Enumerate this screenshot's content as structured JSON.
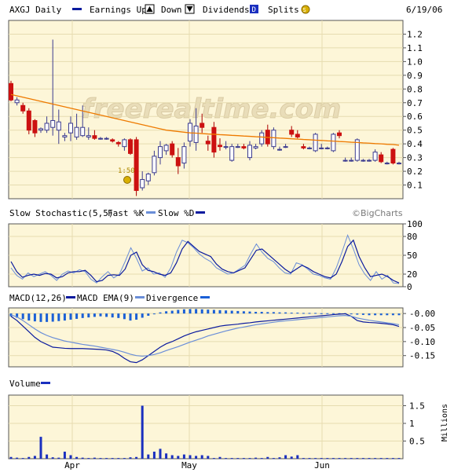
{
  "header": {
    "symbol_label": "AXGJ Daily",
    "legend_earnings": "Earnings Up",
    "legend_down": "Down",
    "legend_dividends": "Dividends",
    "legend_splits": "Splits",
    "date": "6/19/06"
  },
  "watermark": "freerealtime.com",
  "credit": "©BigCharts",
  "split_label": "1:50",
  "colors": {
    "up": "#ffffff",
    "up_border": "#3b3b8f",
    "down": "#cc1111",
    "ma": "#ee7a00",
    "panel_bg": "#fdf6d8",
    "grid": "#e6dcb0",
    "blue_dark": "#0a1a9e",
    "blue_light": "#6a8ed8",
    "hist": "#1a5fd6",
    "volume": "#1a2fbf"
  },
  "chart_data": [
    {
      "type": "candlestick",
      "title": "AXGJ Daily",
      "ylim": [
        0,
        1.3
      ],
      "y_ticks": [
        1.2,
        1.1,
        1.0,
        0.9,
        0.8,
        0.7,
        0.6,
        0.5,
        0.4,
        0.3,
        0.2,
        0.1
      ],
      "x_ticks": [
        "Apr",
        "May",
        "Jun"
      ],
      "ohlc": [
        [
          0.84,
          0.86,
          0.71,
          0.72
        ],
        [
          0.7,
          0.74,
          0.68,
          0.72
        ],
        [
          0.68,
          0.7,
          0.62,
          0.64
        ],
        [
          0.64,
          0.66,
          0.47,
          0.5
        ],
        [
          0.57,
          0.58,
          0.45,
          0.48
        ],
        [
          0.5,
          0.52,
          0.48,
          0.51
        ],
        [
          0.5,
          0.6,
          0.48,
          0.55
        ],
        [
          0.52,
          1.16,
          0.46,
          0.57
        ],
        [
          0.5,
          0.65,
          0.4,
          0.56
        ],
        [
          0.45,
          0.48,
          0.42,
          0.46
        ],
        [
          0.48,
          0.6,
          0.42,
          0.55
        ],
        [
          0.45,
          0.62,
          0.43,
          0.52
        ],
        [
          0.46,
          0.68,
          0.45,
          0.52
        ],
        [
          0.45,
          0.52,
          0.43,
          0.46
        ],
        [
          0.46,
          0.5,
          0.43,
          0.44
        ],
        [
          0.44,
          0.45,
          0.43,
          0.44
        ],
        [
          0.44,
          0.45,
          0.43,
          0.44
        ],
        [
          0.43,
          0.44,
          0.41,
          0.42
        ],
        [
          0.41,
          0.42,
          0.38,
          0.4
        ],
        [
          0.38,
          0.44,
          0.35,
          0.43
        ],
        [
          0.43,
          0.44,
          0.32,
          0.33
        ],
        [
          0.43,
          0.45,
          0.02,
          0.06
        ],
        [
          0.08,
          0.2,
          0.06,
          0.14
        ],
        [
          0.13,
          0.19,
          0.1,
          0.18
        ],
        [
          0.19,
          0.35,
          0.17,
          0.31
        ],
        [
          0.3,
          0.42,
          0.25,
          0.38
        ],
        [
          0.35,
          0.4,
          0.32,
          0.39
        ],
        [
          0.4,
          0.42,
          0.3,
          0.32
        ],
        [
          0.3,
          0.37,
          0.18,
          0.24
        ],
        [
          0.26,
          0.41,
          0.22,
          0.38
        ],
        [
          0.42,
          0.58,
          0.38,
          0.55
        ],
        [
          0.41,
          0.66,
          0.35,
          0.53
        ],
        [
          0.55,
          0.62,
          0.48,
          0.52
        ],
        [
          0.42,
          0.46,
          0.35,
          0.4
        ],
        [
          0.52,
          0.56,
          0.3,
          0.34
        ],
        [
          0.39,
          0.44,
          0.35,
          0.38
        ],
        [
          0.38,
          0.42,
          0.36,
          0.38
        ],
        [
          0.28,
          0.4,
          0.27,
          0.38
        ],
        [
          0.38,
          0.4,
          0.37,
          0.38
        ],
        [
          0.38,
          0.4,
          0.36,
          0.37
        ],
        [
          0.3,
          0.42,
          0.28,
          0.39
        ],
        [
          0.37,
          0.4,
          0.36,
          0.38
        ],
        [
          0.4,
          0.5,
          0.38,
          0.48
        ],
        [
          0.5,
          0.54,
          0.38,
          0.4
        ],
        [
          0.38,
          0.52,
          0.36,
          0.5
        ],
        [
          0.36,
          0.38,
          0.35,
          0.36
        ],
        [
          0.38,
          0.4,
          0.37,
          0.38
        ],
        [
          0.5,
          0.53,
          0.45,
          0.47
        ],
        [
          0.47,
          0.5,
          0.44,
          0.45
        ],
        [
          0.38,
          0.4,
          0.36,
          0.37
        ],
        [
          0.37,
          0.38,
          0.36,
          0.37
        ],
        [
          0.35,
          0.48,
          0.34,
          0.47
        ],
        [
          0.37,
          0.4,
          0.36,
          0.37
        ],
        [
          0.37,
          0.38,
          0.36,
          0.37
        ],
        [
          0.35,
          0.48,
          0.34,
          0.47
        ],
        [
          0.48,
          0.5,
          0.44,
          0.46
        ],
        [
          0.28,
          0.3,
          0.27,
          0.28
        ],
        [
          0.28,
          0.3,
          0.27,
          0.28
        ],
        [
          0.28,
          0.44,
          0.27,
          0.43
        ],
        [
          0.28,
          0.29,
          0.27,
          0.28
        ],
        [
          0.28,
          0.29,
          0.27,
          0.28
        ],
        [
          0.28,
          0.36,
          0.27,
          0.34
        ],
        [
          0.32,
          0.34,
          0.26,
          0.27
        ],
        [
          0.26,
          0.27,
          0.25,
          0.26
        ],
        [
          0.36,
          0.37,
          0.25,
          0.26
        ],
        [
          0.26,
          0.27,
          0.25,
          0.26
        ]
      ],
      "moving_average": [
        0.76,
        0.75,
        0.74,
        0.73,
        0.72,
        0.71,
        0.7,
        0.69,
        0.68,
        0.67,
        0.66,
        0.65,
        0.64,
        0.63,
        0.62,
        0.61,
        0.6,
        0.59,
        0.58,
        0.57,
        0.56,
        0.55,
        0.54,
        0.53,
        0.52,
        0.51,
        0.5,
        0.495,
        0.49,
        0.485,
        0.48,
        0.478,
        0.475,
        0.472,
        0.47,
        0.467,
        0.465,
        0.462,
        0.46,
        0.457,
        0.455,
        0.452,
        0.45,
        0.447,
        0.445,
        0.442,
        0.44,
        0.437,
        0.435,
        0.432,
        0.43,
        0.427,
        0.425,
        0.422,
        0.42,
        0.417,
        0.415,
        0.412,
        0.41,
        0.407,
        0.405,
        0.402,
        0.4,
        0.397,
        0.395,
        0.39
      ]
    },
    {
      "type": "line",
      "title": "Slow Stochastic(5,5)",
      "legend": [
        "Fast %K",
        "Slow %D"
      ],
      "ylim": [
        0,
        100
      ],
      "y_ticks": [
        100,
        80,
        50,
        20,
        0
      ],
      "series": [
        {
          "name": "Fast %K",
          "values": [
            30,
            18,
            12,
            22,
            16,
            20,
            24,
            18,
            10,
            20,
            25,
            22,
            27,
            24,
            12,
            6,
            16,
            24,
            14,
            20,
            40,
            62,
            45,
            25,
            30,
            20,
            22,
            15,
            30,
            55,
            74,
            70,
            62,
            52,
            45,
            40,
            30,
            25,
            20,
            22,
            28,
            34,
            52,
            68,
            55,
            45,
            40,
            30,
            22,
            20,
            38,
            35,
            28,
            20,
            18,
            14,
            12,
            30,
            55,
            82,
            60,
            35,
            20,
            10,
            24,
            12,
            18,
            6,
            5
          ]
        },
        {
          "name": "Slow %D",
          "values": [
            40,
            24,
            15,
            18,
            20,
            18,
            21,
            20,
            14,
            16,
            22,
            24,
            24,
            26,
            18,
            8,
            10,
            18,
            19,
            18,
            28,
            50,
            55,
            35,
            26,
            24,
            20,
            18,
            22,
            38,
            60,
            72,
            64,
            56,
            52,
            48,
            36,
            28,
            24,
            22,
            26,
            30,
            44,
            58,
            60,
            52,
            44,
            36,
            28,
            22,
            28,
            34,
            30,
            24,
            20,
            16,
            14,
            20,
            40,
            64,
            74,
            48,
            30,
            16,
            18,
            20,
            16,
            10,
            6
          ]
        }
      ]
    },
    {
      "type": "line",
      "title": "MACD(12,26)",
      "legend": [
        "MACD EMA(9)",
        "Divergence"
      ],
      "ylim": [
        -0.19,
        0.02
      ],
      "y_ticks": [
        -0.0,
        -0.05,
        -0.1,
        -0.15
      ],
      "series": [
        {
          "name": "MACD(12,26)",
          "values": [
            -0.01,
            -0.025,
            -0.045,
            -0.065,
            -0.085,
            -0.1,
            -0.11,
            -0.12,
            -0.122,
            -0.124,
            -0.125,
            -0.125,
            -0.125,
            -0.126,
            -0.127,
            -0.128,
            -0.13,
            -0.135,
            -0.145,
            -0.16,
            -0.172,
            -0.175,
            -0.165,
            -0.15,
            -0.135,
            -0.12,
            -0.108,
            -0.1,
            -0.09,
            -0.08,
            -0.072,
            -0.065,
            -0.06,
            -0.055,
            -0.05,
            -0.045,
            -0.042,
            -0.04,
            -0.038,
            -0.035,
            -0.033,
            -0.03,
            -0.028,
            -0.026,
            -0.024,
            -0.022,
            -0.02,
            -0.018,
            -0.016,
            -0.014,
            -0.012,
            -0.01,
            -0.008,
            -0.006,
            -0.004,
            -0.002,
            -0.001,
            -0.01,
            -0.025,
            -0.03,
            -0.032,
            -0.033,
            -0.035,
            -0.037,
            -0.04,
            -0.046
          ]
        },
        {
          "name": "MACD EMA(9)",
          "values": [
            -0.005,
            -0.012,
            -0.025,
            -0.04,
            -0.055,
            -0.068,
            -0.078,
            -0.086,
            -0.092,
            -0.098,
            -0.102,
            -0.106,
            -0.11,
            -0.113,
            -0.116,
            -0.12,
            -0.124,
            -0.128,
            -0.132,
            -0.138,
            -0.145,
            -0.15,
            -0.152,
            -0.15,
            -0.146,
            -0.14,
            -0.132,
            -0.125,
            -0.118,
            -0.11,
            -0.102,
            -0.095,
            -0.088,
            -0.08,
            -0.074,
            -0.068,
            -0.062,
            -0.057,
            -0.052,
            -0.048,
            -0.044,
            -0.04,
            -0.037,
            -0.034,
            -0.031,
            -0.028,
            -0.026,
            -0.024,
            -0.022,
            -0.02,
            -0.018,
            -0.016,
            -0.014,
            -0.012,
            -0.01,
            -0.008,
            -0.007,
            -0.01,
            -0.016,
            -0.02,
            -0.024,
            -0.027,
            -0.03,
            -0.033,
            -0.036,
            -0.04
          ]
        },
        {
          "name": "Divergence",
          "values": [
            -0.01,
            -0.015,
            -0.02,
            -0.025,
            -0.028,
            -0.03,
            -0.03,
            -0.029,
            -0.027,
            -0.025,
            -0.022,
            -0.019,
            -0.016,
            -0.014,
            -0.012,
            -0.01,
            -0.012,
            -0.014,
            -0.016,
            -0.02,
            -0.025,
            -0.022,
            -0.015,
            -0.008,
            -0.002,
            0.004,
            0.008,
            0.01,
            0.013,
            0.015,
            0.016,
            0.016,
            0.015,
            0.014,
            0.013,
            0.012,
            0.011,
            0.01,
            0.009,
            0.008,
            0.007,
            0.006,
            0.006,
            0.005,
            0.005,
            0.004,
            0.004,
            0.003,
            0.003,
            0.002,
            0.002,
            0.002,
            0.001,
            0.001,
            0.001,
            0.001,
            0.001,
            -0.002,
            -0.004,
            -0.005,
            -0.006,
            -0.006,
            -0.006,
            -0.006,
            -0.006,
            -0.006
          ]
        }
      ]
    },
    {
      "type": "bar",
      "title": "Volume",
      "ylabel": "Millions",
      "ylim": [
        0,
        1.8
      ],
      "y_ticks": [
        1.5,
        1,
        0.5
      ],
      "values": [
        0.05,
        0.03,
        0.02,
        0.05,
        0.08,
        0.62,
        0.12,
        0.04,
        0.03,
        0.2,
        0.1,
        0.05,
        0.03,
        0.02,
        0.03,
        0.02,
        0.02,
        0.02,
        0.02,
        0.02,
        0.04,
        0.05,
        1.5,
        0.12,
        0.2,
        0.28,
        0.15,
        0.1,
        0.08,
        0.12,
        0.1,
        0.08,
        0.1,
        0.08,
        0.02,
        0.05,
        0.02,
        0.02,
        0.02,
        0.02,
        0.02,
        0.03,
        0.02,
        0.05,
        0.02,
        0.04,
        0.1,
        0.06,
        0.1,
        0.02,
        0.02,
        0.02,
        0.02,
        0.02,
        0.02,
        0.02,
        0.02,
        0.02,
        0.02,
        0.02,
        0.02,
        0.02,
        0.02,
        0.02,
        0.02,
        0.02
      ]
    }
  ]
}
